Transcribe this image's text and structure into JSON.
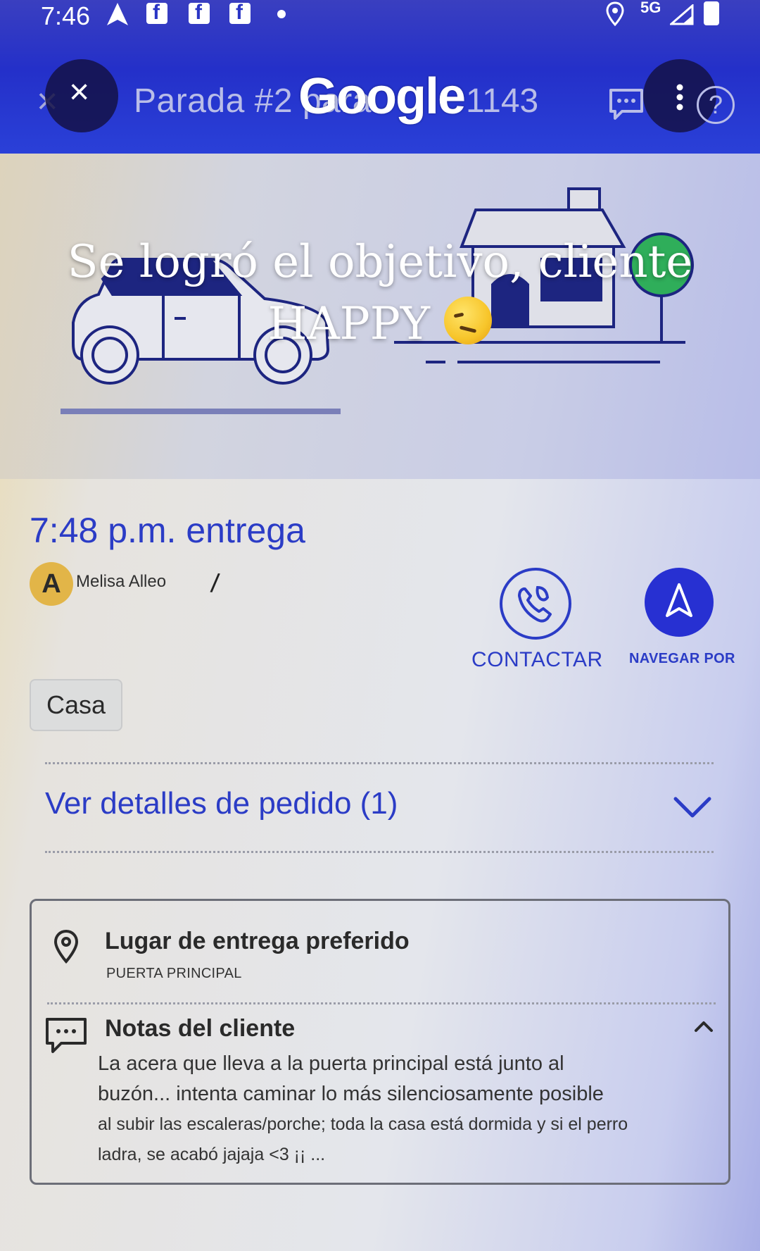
{
  "status_bar": {
    "time": "7:46",
    "network": "5G",
    "icons": [
      "navigation-icon",
      "facebook-icon",
      "facebook-icon",
      "facebook-icon",
      "dot-icon",
      "location-icon",
      "signal-icon",
      "battery-icon"
    ]
  },
  "header": {
    "close_label": "×",
    "title": "Parada #2 para",
    "order_number": "1143",
    "google_logo": "Google",
    "help_label": "?"
  },
  "overlay": {
    "caption": "Se logró el objetivo, cliente HAPPY",
    "emoji": "woozy-face"
  },
  "delivery": {
    "time_label": "7:48 p.m. entrega",
    "avatar_initial": "A",
    "customer_name": "Melisa Alleo",
    "contact_label": "CONTACTAR",
    "navigate_label": "NAVEGAR POR",
    "tag": "Casa"
  },
  "order_details": {
    "label": "Ver detalles de pedido (1)"
  },
  "card": {
    "preferred_title": "Lugar de entrega preferido",
    "preferred_value": "PUERTA PRINCIPAL",
    "notes_title": "Notas del cliente",
    "notes_lines": [
      "La acera que lleva a la puerta principal está junto al",
      "buzón... intenta caminar lo más silenciosamente posible",
      "al subir las escaleras/porche; toda la casa está dormida y si el perro",
      "ladra, se acabó jajaja <3 ¡¡ ..."
    ]
  },
  "colors": {
    "accent": "#2b3cc6",
    "header": "#2430c9",
    "nav_button": "#2730d2",
    "tree": "#2fae5a",
    "avatar": "#e2b548"
  }
}
